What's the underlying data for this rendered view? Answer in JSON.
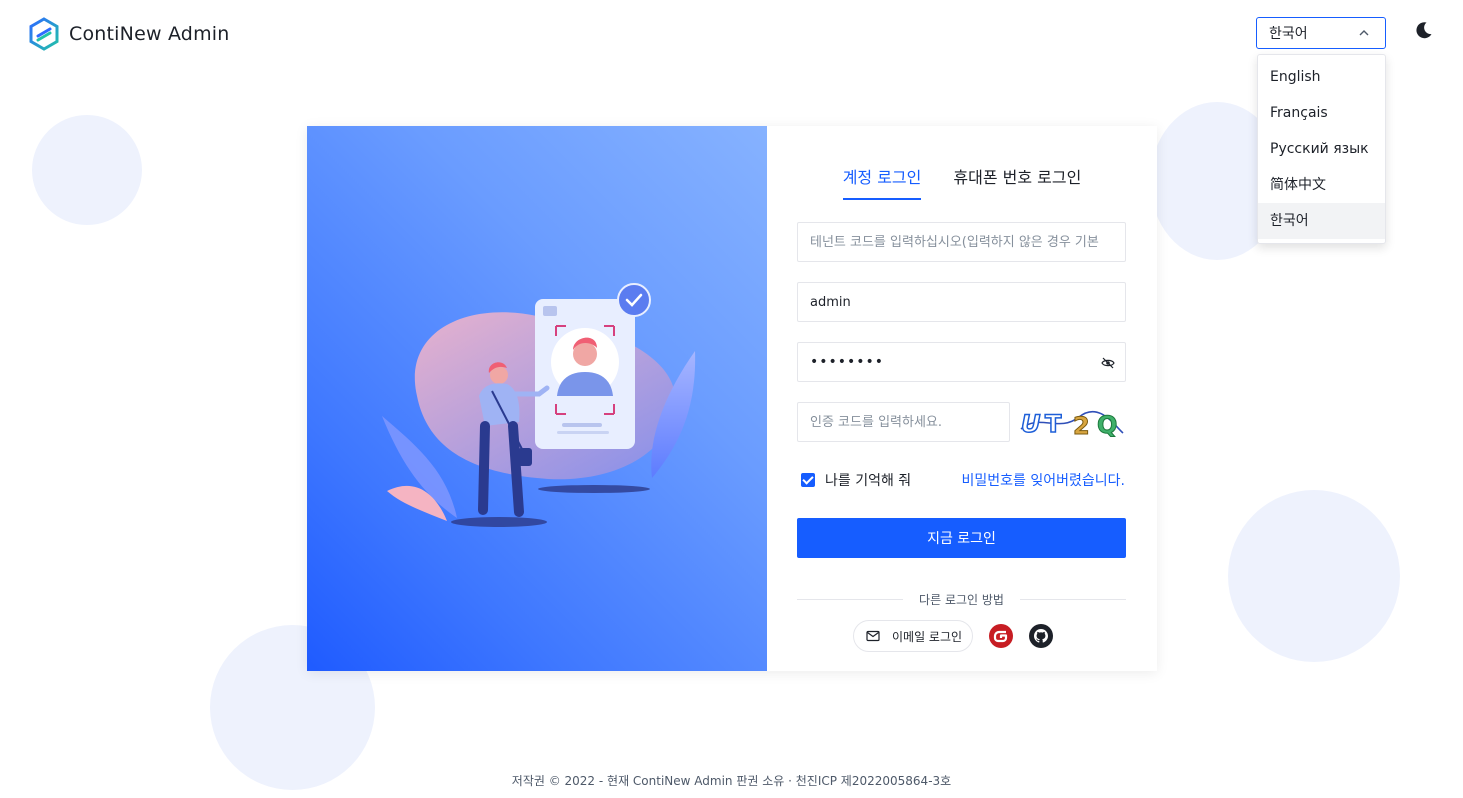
{
  "brand": {
    "name": "ContiNew Admin"
  },
  "header": {
    "language_selected": "한국어",
    "language_options": [
      "English",
      "Français",
      "Русский язык",
      "简体中文",
      "한국어"
    ]
  },
  "login": {
    "tabs": [
      "계정 로그인",
      "휴대폰 번호 로그인"
    ],
    "tenant_placeholder": "테넌트 코드를 입력하십시오(입력하지 않은 경우 기본",
    "username_value": "admin",
    "password_masked": "••••••••",
    "captcha_placeholder": "인증 코드를 입력하세요.",
    "captcha_text": "UT2Q",
    "remember_label": "나를 기억해 줘",
    "forgot_label": "비밀번호를 잊어버렸습니다.",
    "submit_label": "지금 로그인",
    "other_methods_label": "다른 로그인 방법",
    "email_login_label": "이메일 로그인"
  },
  "footer": {
    "text": "저작권 © 2022 - 현재 ContiNew Admin 판권 소유 · 천진ICP 제2022005864-3호"
  },
  "colors": {
    "primary": "#165dff",
    "hero_start": "#86b2ff",
    "hero_end": "#1f5bff",
    "gitee": "#c71d23"
  },
  "icons": [
    "logo-icon",
    "chevron-up-icon",
    "moon-icon",
    "eye-icon",
    "mail-icon",
    "gitee-icon",
    "github-icon"
  ]
}
